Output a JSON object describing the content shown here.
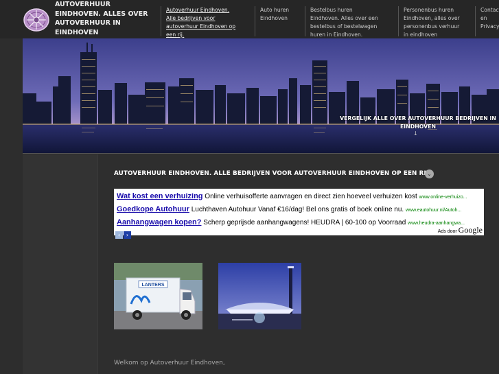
{
  "header": {
    "site_title": "AUTOVERHUUR EINDHOVEN. ALLES OVER AUTOVERHUUR IN EINDHOVEN",
    "nav": [
      {
        "label": "Autoverhuur Eindhoven. Alle bedrijven voor autoverhuur Eindhoven op een rij."
      },
      {
        "label": "Auto huren Eindhoven"
      },
      {
        "label": "Bestelbus huren Eindhoven. Alles over een bestelbus of bestelwagen huren in Eindhoven."
      },
      {
        "label": "Personenbus huren Eindhoven, alles over personenbus verhuur in eindhoven"
      },
      {
        "label": "Contact en Privacy"
      }
    ]
  },
  "hero": {
    "caption": "VERGELIJK ALLE OVER AUTOVERHUUR BEDRIJVEN IN EINDHOVEN",
    "arrow": "↓"
  },
  "main": {
    "heading": "AUTOVERHUUR EINDHOVEN. ALLE BEDRIJVEN VOOR AUTOVERHUUR EINDHOVEN OP EEN RIJ.",
    "heading_icon": "⌄",
    "ads": [
      {
        "title": "Wat kost een verhuizing",
        "text": "Online verhuisofferte aanvragen en direct zien hoeveel verhuizen kost",
        "url": "www.online-verhuizo..."
      },
      {
        "title": "Goedkope Autohuur",
        "text": "Luchthaven Autohuur Vanaf €16/dag! Bel ons gratis of boek online nu.",
        "url": "www.eautohuur.nl/Autoh..."
      },
      {
        "title": "Aanhangwagen kopen?",
        "text": "Scherp geprijsde aanhangwagens! HEUDRA | 60-100 op Voorraad",
        "url": "www.heudra-aanhangwa..."
      }
    ],
    "ads_by_label": "Ads door",
    "ads_by_brand": "Google",
    "ad_prev": "‹",
    "ad_next": "›",
    "welcome": "Welkom op Autoverhuur Eindhoven,",
    "truck_logo": "LANTERS"
  },
  "colors": {
    "background": "#2e2e2e",
    "header": "#262626",
    "ad_link": "#1a0dab",
    "ad_url": "#008000"
  }
}
